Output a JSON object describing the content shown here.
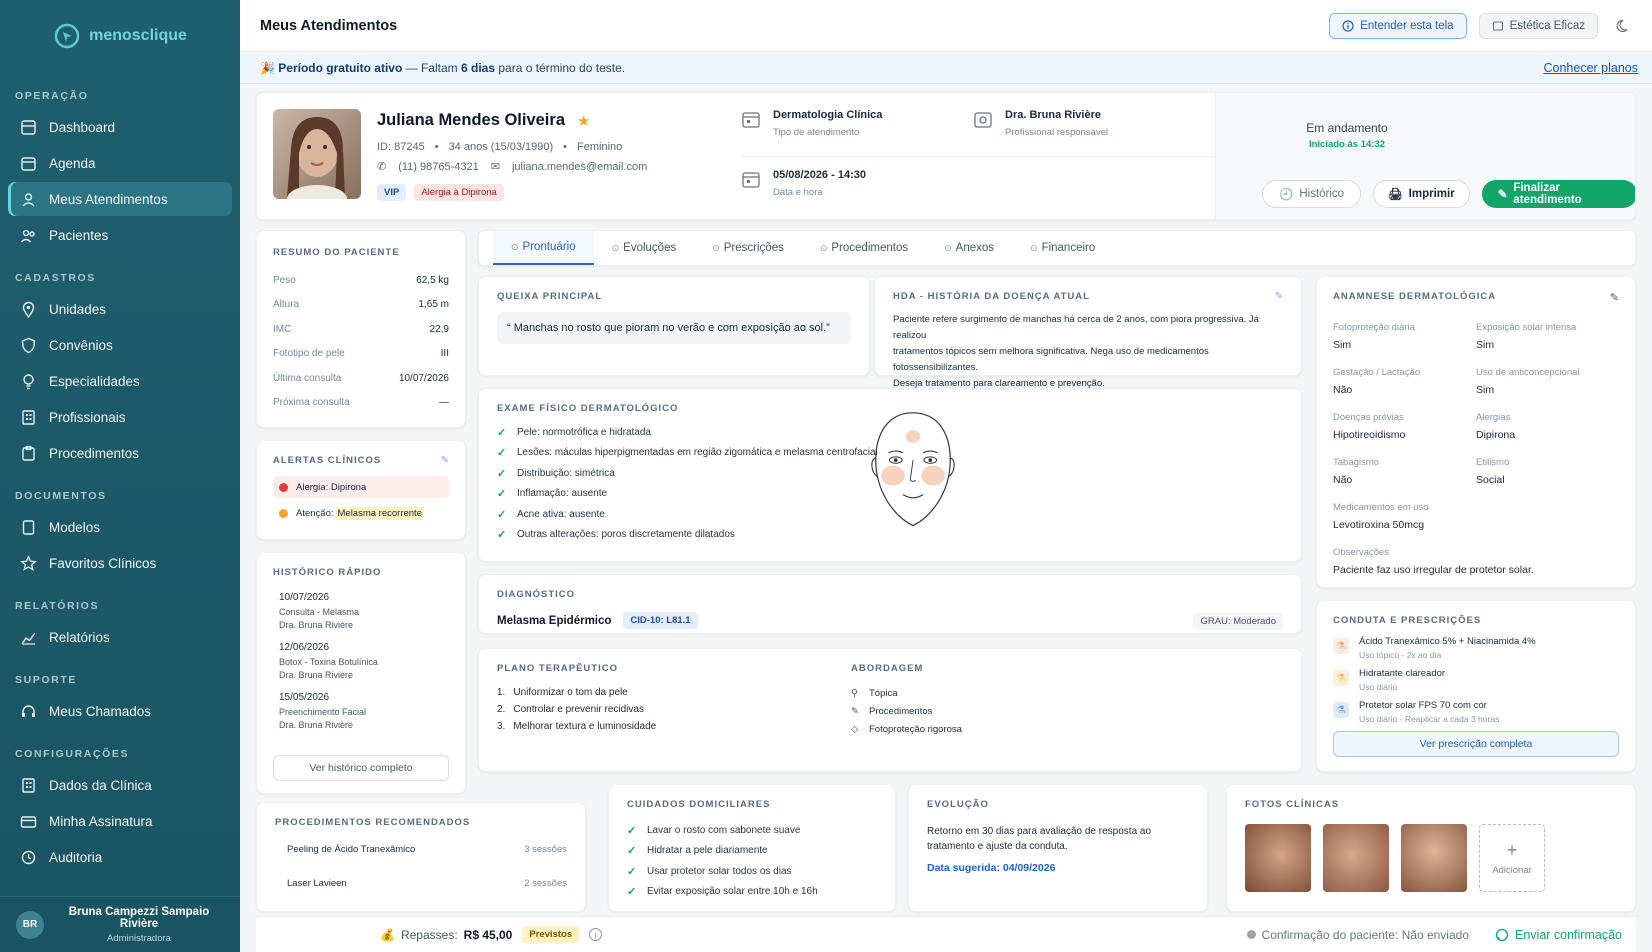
{
  "sidebar": {
    "logo_text": "menosclique",
    "sections": [
      {
        "title": "OPERAÇÃO",
        "items": [
          {
            "label": "Dashboard",
            "icon": "dashboard-icon"
          },
          {
            "label": "Agenda",
            "icon": "calendar-icon"
          },
          {
            "label": "Meus Atendimentos",
            "icon": "user-icon",
            "active": true
          },
          {
            "label": "Pacientes",
            "icon": "users-icon"
          }
        ]
      },
      {
        "title": "CADASTROS",
        "items": [
          {
            "label": "Unidades",
            "icon": "location-icon"
          },
          {
            "label": "Convênios",
            "icon": "shield-icon"
          },
          {
            "label": "Especialidades",
            "icon": "bulb-icon"
          },
          {
            "label": "Profissionais",
            "icon": "building-icon"
          },
          {
            "label": "Procedimentos",
            "icon": "clipboard-icon"
          }
        ]
      },
      {
        "title": "DOCUMENTOS",
        "items": [
          {
            "label": "Modelos",
            "icon": "document-icon"
          },
          {
            "label": "Favoritos Clínicos",
            "icon": "star-icon"
          }
        ]
      },
      {
        "title": "RELATÓRIOS",
        "items": [
          {
            "label": "Relatórios",
            "icon": "chart-icon"
          }
        ]
      },
      {
        "title": "SUPORTE",
        "items": [
          {
            "label": "Meus Chamados",
            "icon": "headset-icon"
          }
        ]
      },
      {
        "title": "CONFIGURAÇÕES",
        "items": [
          {
            "label": "Dados da Clínica",
            "icon": "building-icon"
          },
          {
            "label": "Minha Assinatura",
            "icon": "card-icon"
          },
          {
            "label": "Auditoria",
            "icon": "audit-icon"
          }
        ]
      }
    ],
    "user": {
      "initials": "BR",
      "name": "Bruna Campezzi Sampaio Rivière",
      "role": "Administradora"
    }
  },
  "header": {
    "title": "Meus Atendimentos",
    "help_button": "Entender esta tela",
    "clinic_button": "Estética Eficaz"
  },
  "trial": {
    "strong": "Período gratuito ativo",
    "text1": " — Faltam ",
    "days": "6 dias",
    "text2": " para o término do teste.",
    "link": "Conhecer planos"
  },
  "patient": {
    "name": "Juliana Mendes Oliveira",
    "id": "ID: 87245",
    "age": "34 anos (15/03/1990)",
    "gender": "Feminino",
    "phone": "(11) 98765-4321",
    "email": "juliana.mendes@email.com",
    "tag_vip": "VIP",
    "tag_allergy": "Alergia à Dipirona",
    "type": "Dermatologia Clínica",
    "type_label": "Tipo de atendimento",
    "doctor": "Dra. Bruna Rivière",
    "doctor_label": "Profissional responsável",
    "datetime": "05/08/2026 - 14:30",
    "datetime_label": "Data e hora",
    "status": "Em andamento",
    "status_since": "Iniciado às 14:32",
    "btn_history": "Histórico",
    "btn_print": "Imprimir",
    "btn_finish": "Finalizar atendimento"
  },
  "summary": {
    "title": "RESUMO DO PACIENTE",
    "rows": [
      {
        "k": "Peso",
        "v": "62,5 kg"
      },
      {
        "k": "Altura",
        "v": "1,65 m"
      },
      {
        "k": "IMC",
        "v": "22,9"
      },
      {
        "k": "Fototipo de pele",
        "v": "III"
      },
      {
        "k": "Última consulta",
        "v": "10/07/2026"
      },
      {
        "k": "Próxima consulta",
        "v": "—"
      }
    ]
  },
  "alerts": {
    "title": "ALERTAS CLÍNICOS",
    "a1": "Alergia: Dipirona",
    "a2_prefix": "Atenção: ",
    "a2_hl": "Melasma recorrente"
  },
  "history": {
    "title": "HISTÓRICO RÁPIDO",
    "items": [
      {
        "date": "10/07/2026",
        "desc": "Consulta - Melasma",
        "doc": "Dra. Bruna Rivière"
      },
      {
        "date": "12/06/2026",
        "desc": "Botox - Toxina Botulínica",
        "doc": "Dra. Bruna Rivière"
      },
      {
        "date": "15/05/2026",
        "desc": "Preenchimento Facial",
        "doc": "Dra. Bruna Rivière"
      }
    ],
    "button": "Ver histórico completo"
  },
  "tabs": [
    "Prontuário",
    "Evoluções",
    "Prescrições",
    "Procedimentos",
    "Anexos",
    "Financeiro"
  ],
  "complaint": {
    "title": "QUEIXA PRINCIPAL",
    "text": "“ Manchas no rosto que pioram no verão e com exposição ao sol.”"
  },
  "hda": {
    "title": "HDA - HISTÓRIA DA DOENÇA ATUAL",
    "l1": "Paciente refere surgimento de manchas há cerca de 2 anos, com piora progressiva. Já realizou",
    "l2": "tratamentos tópicos sem melhora significativa. Nega uso de medicamentos fotossensibilizantes.",
    "l3": "Deseja tratamento para clareamento e prevenção."
  },
  "exam": {
    "title": "EXAME FÍSICO DERMATOLÓGICO",
    "items": [
      "Pele: normotrófica e hidratada",
      "Lesões: máculas hiperpigmentadas em região zigomática e melasma centrofacial",
      "Distribuição: simétrica",
      "Inflamação: ausente",
      "Acne ativa: ausente",
      "Outras alterações: poros discretamente dilatados"
    ]
  },
  "diagnosis": {
    "title": "DIAGNÓSTICO",
    "name": "Melasma Epidérmico",
    "cid": "CID-10: L81.1",
    "grade": "GRAU: Moderado"
  },
  "plan": {
    "title": "PLANO TERAPÊUTICO",
    "items": [
      "Uniformizar o tom da pele",
      "Controlar e prevenir recidivas",
      "Melhorar textura e luminosidade"
    ],
    "approach_title": "ABORDAGEM",
    "approach": [
      "Tópica",
      "Procedimentos",
      "Fotoproteção rigorosa"
    ]
  },
  "anamnesis": {
    "title": "ANAMNESE DERMATOLÓGICA",
    "pairs": [
      [
        {
          "k": "Fotoproteção diária",
          "v": "Sim"
        },
        {
          "k": "Exposição solar intensa",
          "v": "Sim"
        }
      ],
      [
        {
          "k": "Gestação / Lactação",
          "v": "Não"
        },
        {
          "k": "Uso de anticoncepcional",
          "v": "Sim"
        }
      ],
      [
        {
          "k": "Doenças prévias",
          "v": "Hipotireoidismo"
        },
        {
          "k": "Alergias",
          "v": "Dipirona"
        }
      ],
      [
        {
          "k": "Tabagismo",
          "v": "Não"
        },
        {
          "k": "Etilismo",
          "v": "Social"
        }
      ]
    ],
    "meds_k": "Medicamentos em uso",
    "meds_v": "Levotiroxina 50mcg",
    "obs_k": "Observações",
    "obs_v": "Paciente faz uso irregular de protetor solar."
  },
  "conduct": {
    "title": "CONDUTA E PRESCRIÇÕES",
    "items": [
      {
        "name": "Ácido Tranexâmico 5% + Niacinamida 4%",
        "use": "Uso tópico - 2x ao dia",
        "color": "#f59e6b"
      },
      {
        "name": "Hidratante clareador",
        "use": "Uso diário",
        "color": "#f7b34a"
      },
      {
        "name": "Protetor solar FPS 70 com cor",
        "use": "Uso diário - Reaplicar a cada 3 horas",
        "color": "#5b9cf0"
      }
    ],
    "button": "Ver prescrição completa"
  },
  "procedures": {
    "title": "PROCEDIMENTOS RECOMENDADOS",
    "items": [
      {
        "name": "Peeling de Ácido Tranexâmico",
        "sessions": "3 sessões"
      },
      {
        "name": "Laser Lavieen",
        "sessions": "2 sessões"
      }
    ]
  },
  "homecare": {
    "title": "CUIDADOS DOMICILIARES",
    "items": [
      "Lavar o rosto com sabonete suave",
      "Hidratar a pele diariamente",
      "Usar protetor solar todos os dias",
      "Evitar exposição solar entre 10h e 16h"
    ]
  },
  "evolution": {
    "title": "EVOLUÇÃO",
    "l1": "Retorno em 30 dias para avaliação de resposta ao",
    "l2": "tratamento e ajuste da conduta.",
    "date": "Data sugerida: 04/09/2026"
  },
  "photos": {
    "title": "FOTOS CLÍNICAS",
    "add": "Adicionar"
  },
  "footer": {
    "repasses_label": "Repasses: ",
    "repasses_value": "R$ 45,00",
    "badge": "Previstos",
    "confirm": "Confirmação do paciente: Não enviado",
    "send": "Enviar confirmação"
  },
  "colors": {
    "sidebar": "#1f5f6e",
    "accent": "#2a64c8",
    "success": "#10a46b"
  }
}
